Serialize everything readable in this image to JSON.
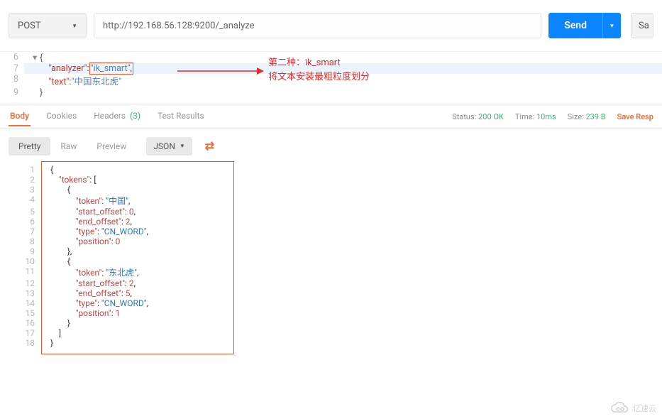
{
  "request": {
    "method": "POST",
    "url": "http://192.168.56.128:9200/_analyze",
    "send_label": "Send",
    "save_label": "Sa"
  },
  "request_body": {
    "line6_no": "6",
    "line7_no": "7",
    "line8_no": "8",
    "line9_no": "9",
    "line6": "{",
    "key_analyzer": "\"analyzer\"",
    "val_analyzer": "\"ik_smart\"",
    "key_text": "\"text\"",
    "val_text": "\"中国东北虎\"",
    "line9": "}"
  },
  "annotations": {
    "line1": "第二种：ik_smart",
    "line2": "将文本安装最粗粒度划分"
  },
  "chart_data": {
    "type": "table",
    "title": "_analyze response tokens",
    "columns": [
      "token",
      "start_offset",
      "end_offset",
      "type",
      "position"
    ],
    "rows": [
      [
        "中国",
        0,
        2,
        "CN_WORD",
        0
      ],
      [
        "东北虎",
        2,
        5,
        "CN_WORD",
        1
      ]
    ]
  },
  "response_tabs": {
    "body": "Body",
    "cookies": "Cookies",
    "headers": "Headers",
    "headers_count": "(3)",
    "test": "Test Results"
  },
  "response_meta": {
    "status_label": "Status:",
    "status_value": "200 OK",
    "time_label": "Time:",
    "time_value": "10ms",
    "size_label": "Size:",
    "size_value": "239 B",
    "save_response": "Save Resp"
  },
  "format_tabs": {
    "pretty": "Pretty",
    "raw": "Raw",
    "preview": "Preview",
    "json": "JSON"
  },
  "response_body": {
    "ln1": "1",
    "c1": "{",
    "ln2": "2",
    "k_tokens": "\"tokens\"",
    "ln3": "3",
    "c3": "{",
    "ln4": "4",
    "k_token": "\"token\"",
    "v_token1": "\"中国\"",
    "ln5": "5",
    "k_so": "\"start_offset\"",
    "v_so1": "0",
    "ln6": "6",
    "k_eo": "\"end_offset\"",
    "v_eo1": "2",
    "ln7": "7",
    "k_type": "\"type\"",
    "v_type": "\"CN_WORD\"",
    "ln8": "8",
    "k_pos": "\"position\"",
    "v_pos1": "0",
    "ln9": "9",
    "c9": "},",
    "ln10": "10",
    "c10": "{",
    "ln11": "11",
    "v_token2": "\"东北虎\"",
    "ln12": "12",
    "v_so2": "2",
    "ln13": "13",
    "v_eo2": "5",
    "ln14": "14",
    "ln15": "15",
    "v_pos2": "1",
    "ln16": "16",
    "c16": "}",
    "ln17": "17",
    "c17": "]",
    "ln18": "18",
    "c18": "}"
  },
  "watermark": "亿速云"
}
